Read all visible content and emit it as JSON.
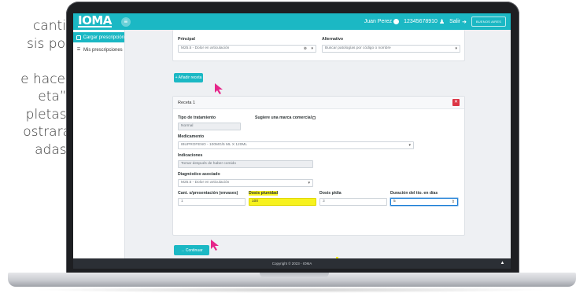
{
  "caption_lines": [
    "canti-",
    "sis por",
    "",
    "e hacer",
    "eta”.",
    "pletas,",
    "ostrará",
    "adas."
  ],
  "colors": {
    "brand_teal": "#1bb8c4",
    "danger": "#dc3545",
    "highlight": "#f7f21e",
    "cursor": "#e6268a",
    "footer_bg": "#2b2f35"
  },
  "header": {
    "logo": "IOMA",
    "menu_icon": "hamburger-icon",
    "user_name": "Juan Perez",
    "user_id": "12345678910",
    "logout_label": "Salir",
    "province_logo": "BUENOS AIRES"
  },
  "sidebar": {
    "items": [
      {
        "label": "Cargar prescripción",
        "icon": "document-icon",
        "active": true
      },
      {
        "label": "Mis prescripciones",
        "icon": "list-icon",
        "active": false
      }
    ]
  },
  "diagnosis": {
    "principal_label": "Principal",
    "principal_value": "M25.5 - Dolor en articulación",
    "alternativo_label": "Alternativo",
    "alternativo_placeholder": "Buscar patologías por código o nombre"
  },
  "add_button_label": "+ Añadir receta",
  "receta": {
    "title": "Receta 1",
    "close_icon": "close-icon",
    "tipo_label": "Tipo de tratamiento",
    "tipo_value": "Normal",
    "marca_label": "Sugiere una marca comercial",
    "medicamento_label": "Medicamento",
    "medicamento_value": "IBUPROFENO - 100MG/5 ML X 120ML",
    "indicaciones_label": "Indicaciones",
    "indicaciones_value": "Tomar después de haber comido",
    "diagnostico_label": "Diagnóstico asociado",
    "diagnostico_value": "M25.5 - Dolor en articulación",
    "cant_label": "Cant. s/presentación (envases)",
    "cant_value": "1",
    "dosis_unidad_label": "Dosis p/unidad",
    "dosis_unidad_value": "100",
    "dosis_dia_label": "Dosis p/día",
    "dosis_dia_value": "3",
    "duracion_label": "Duración del tto. en días",
    "duracion_value": "5"
  },
  "continue_button_label": "→ Continuar",
  "footer": {
    "copyright": "Copyright © 2023 - IOMA",
    "scroll_icon": "chevron-up-icon"
  }
}
